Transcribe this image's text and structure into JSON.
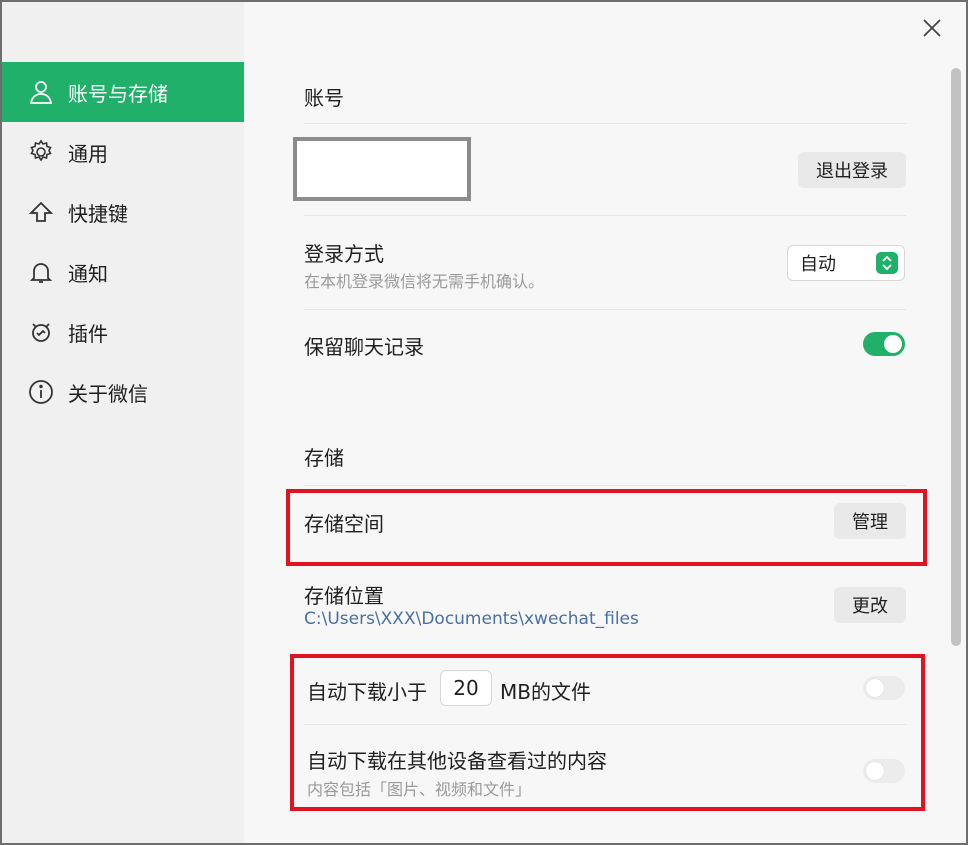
{
  "sidebar": {
    "items": [
      {
        "label": "账号与存储",
        "icon": "person-icon",
        "active": true
      },
      {
        "label": "通用",
        "icon": "gear-icon",
        "active": false
      },
      {
        "label": "快捷键",
        "icon": "arrow-up-icon",
        "active": false
      },
      {
        "label": "通知",
        "icon": "bell-icon",
        "active": false
      },
      {
        "label": "插件",
        "icon": "plugin-icon",
        "active": false
      },
      {
        "label": "关于微信",
        "icon": "info-icon",
        "active": false
      }
    ]
  },
  "account": {
    "section_title": "账号",
    "logout_label": "退出登录",
    "login_method": {
      "label": "登录方式",
      "description": "在本机登录微信将无需手机确认。",
      "value": "自动"
    },
    "keep_chat": {
      "label": "保留聊天记录",
      "enabled": true
    }
  },
  "storage": {
    "section_title": "存储",
    "space": {
      "label": "存储空间",
      "button": "管理"
    },
    "location": {
      "label": "存储位置",
      "path": "C:\\Users\\XXX\\Documents\\xwechat_files",
      "button": "更改"
    },
    "auto_download": {
      "prefix": "自动下载小于",
      "size_mb": "20",
      "suffix": "MB的文件",
      "enabled": false
    },
    "auto_download_seen": {
      "label": "自动下载在其他设备查看过的内容",
      "description": "内容包括「图片、视频和文件」",
      "enabled": false
    }
  },
  "colors": {
    "accent": "#20b06a",
    "highlight": "#e0141e",
    "path": "#4a6fa5"
  }
}
